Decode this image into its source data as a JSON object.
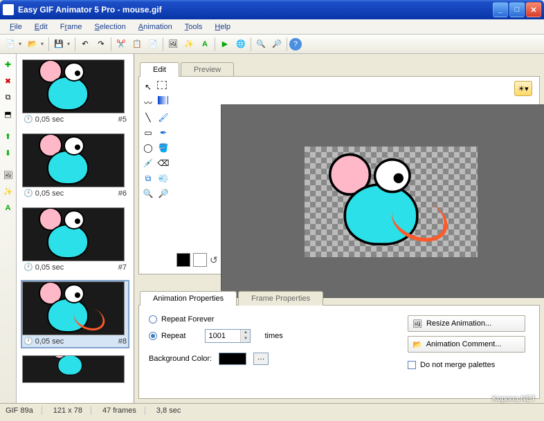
{
  "window": {
    "title": "Easy GIF Animator 5 Pro - mouse.gif"
  },
  "menu": [
    "File",
    "Edit",
    "Frame",
    "Selection",
    "Animation",
    "Tools",
    "Help"
  ],
  "frames": [
    {
      "time": "0,05 sec",
      "num": "#5",
      "sel": false
    },
    {
      "time": "0,05 sec",
      "num": "#6",
      "sel": false
    },
    {
      "time": "0,05 sec",
      "num": "#7",
      "sel": false
    },
    {
      "time": "0,05 sec",
      "num": "#8",
      "sel": true
    },
    {
      "time": "",
      "num": "",
      "sel": false
    }
  ],
  "tabs": {
    "edit": "Edit",
    "preview": "Preview"
  },
  "props": {
    "tab1": "Animation Properties",
    "tab2": "Frame Properties",
    "repeatForever": "Repeat Forever",
    "repeat": "Repeat",
    "times": "times",
    "repeatValue": "1001",
    "bgLabel": "Background Color:",
    "resize": "Resize Animation...",
    "comment": "Animation Comment...",
    "merge": "Do not merge palettes"
  },
  "status": {
    "ver": "GIF 89a",
    "dim": "121 x 78",
    "frames": "47 frames",
    "dur": "3,8 sec"
  },
  "watermark": "Kopona.NET"
}
